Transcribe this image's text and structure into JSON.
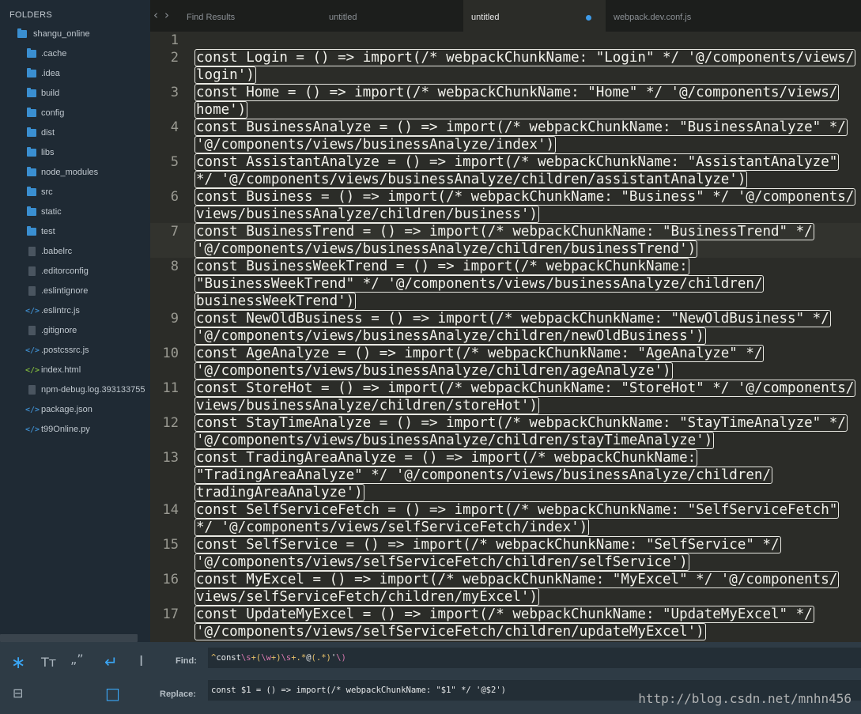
{
  "sidebar": {
    "header": "FOLDERS",
    "root": "shangu_online",
    "items": [
      {
        "label": ".cache",
        "icon": "folder-icon"
      },
      {
        "label": ".idea",
        "icon": "folder-icon"
      },
      {
        "label": "build",
        "icon": "folder-icon"
      },
      {
        "label": "config",
        "icon": "folder-icon"
      },
      {
        "label": "dist",
        "icon": "folder-icon"
      },
      {
        "label": "libs",
        "icon": "folder-icon"
      },
      {
        "label": "node_modules",
        "icon": "folder-icon"
      },
      {
        "label": "src",
        "icon": "folder-icon"
      },
      {
        "label": "static",
        "icon": "folder-icon"
      },
      {
        "label": "test",
        "icon": "folder-icon"
      },
      {
        "label": ".babelrc",
        "icon": "file-icon"
      },
      {
        "label": ".editorconfig",
        "icon": "file-icon"
      },
      {
        "label": ".eslintignore",
        "icon": "file-icon"
      },
      {
        "label": ".eslintrc.js",
        "icon": "code-file-icon"
      },
      {
        "label": ".gitignore",
        "icon": "file-icon"
      },
      {
        "label": ".postcssrc.js",
        "icon": "code-file-icon"
      },
      {
        "label": "index.html",
        "icon": "html-file-icon"
      },
      {
        "label": "npm-debug.log.393133755",
        "icon": "file-icon"
      },
      {
        "label": "package.json",
        "icon": "code-file-icon"
      },
      {
        "label": "t99Online.py",
        "icon": "code-file-icon"
      }
    ]
  },
  "tabs": [
    {
      "label": "Find Results",
      "active": false
    },
    {
      "label": "untitled",
      "active": false
    },
    {
      "label": "untitled",
      "active": true,
      "modified": true
    },
    {
      "label": "webpack.dev.conf.js",
      "active": false
    }
  ],
  "editor": {
    "current_line": 7,
    "lines": [
      {
        "n": "1",
        "text": []
      },
      {
        "n": "2",
        "text": [
          "const Login = () => import(/* webpackChunkName: \"Login\" */ '@/components/views/",
          "login')"
        ]
      },
      {
        "n": "3",
        "text": [
          "const Home = () => import(/* webpackChunkName: \"Home\" */ '@/components/views/",
          "home')"
        ]
      },
      {
        "n": "4",
        "text": [
          "const BusinessAnalyze = () => import(/* webpackChunkName: \"BusinessAnalyze\" */",
          "'@/components/views/businessAnalyze/index')"
        ]
      },
      {
        "n": "5",
        "text": [
          "const AssistantAnalyze = () => import(/* webpackChunkName: \"AssistantAnalyze\"",
          "*/ '@/components/views/businessAnalyze/children/assistantAnalyze')"
        ]
      },
      {
        "n": "6",
        "text": [
          "const Business = () => import(/* webpackChunkName: \"Business\" */ '@/components/",
          "views/businessAnalyze/children/business')"
        ]
      },
      {
        "n": "7",
        "text": [
          "const BusinessTrend = () => import(/* webpackChunkName: \"BusinessTrend\" */",
          "'@/components/views/businessAnalyze/children/businessTrend')"
        ]
      },
      {
        "n": "8",
        "text": [
          "const BusinessWeekTrend = () => import(/* webpackChunkName:",
          "\"BusinessWeekTrend\" */ '@/components/views/businessAnalyze/children/",
          "businessWeekTrend')"
        ]
      },
      {
        "n": "9",
        "text": [
          "const NewOldBusiness = () => import(/* webpackChunkName: \"NewOldBusiness\" */",
          "'@/components/views/businessAnalyze/children/newOldBusiness')"
        ]
      },
      {
        "n": "10",
        "text": [
          "const AgeAnalyze = () => import(/* webpackChunkName: \"AgeAnalyze\" */",
          "'@/components/views/businessAnalyze/children/ageAnalyze')"
        ]
      },
      {
        "n": "11",
        "text": [
          "const StoreHot = () => import(/* webpackChunkName: \"StoreHot\" */ '@/components/",
          "views/businessAnalyze/children/storeHot')"
        ]
      },
      {
        "n": "12",
        "text": [
          "const StayTimeAnalyze = () => import(/* webpackChunkName: \"StayTimeAnalyze\" */",
          "'@/components/views/businessAnalyze/children/stayTimeAnalyze')"
        ]
      },
      {
        "n": "13",
        "text": [
          "const TradingAreaAnalyze = () => import(/* webpackChunkName:",
          "\"TradingAreaAnalyze\" */ '@/components/views/businessAnalyze/children/",
          "tradingAreaAnalyze')"
        ]
      },
      {
        "n": "14",
        "text": [
          "const SelfServiceFetch = () => import(/* webpackChunkName: \"SelfServiceFetch\"",
          "*/ '@/components/views/selfServiceFetch/index')"
        ]
      },
      {
        "n": "15",
        "text": [
          "const SelfService = () => import(/* webpackChunkName: \"SelfService\" */",
          "'@/components/views/selfServiceFetch/children/selfService')"
        ]
      },
      {
        "n": "16",
        "text": [
          "const MyExcel = () => import(/* webpackChunkName: \"MyExcel\" */ '@/components/",
          "views/selfServiceFetch/children/myExcel')"
        ]
      },
      {
        "n": "17",
        "text": [
          "const UpdateMyExcel = () => import(/* webpackChunkName: \"UpdateMyExcel\" */",
          "'@/components/views/selfServiceFetch/children/updateMyExcel')"
        ]
      }
    ]
  },
  "find_panel": {
    "find_label": "Find:",
    "replace_label": "Replace:",
    "find_value": "^const\\s+(\\w+)\\s+.*@(.*)'\\)",
    "replace_value": "const $1 = () => import(/* webpackChunkName: \"$1\" */ '@$2')",
    "options": [
      {
        "name": "regex-icon",
        "glyph": "∗",
        "on": true
      },
      {
        "name": "case-sensitive-icon",
        "glyph": "Tт",
        "on": false
      },
      {
        "name": "whole-word-icon",
        "glyph": "„”",
        "on": false
      },
      {
        "name": "wrap-icon",
        "glyph": "↵",
        "on": true
      },
      {
        "name": "in-selection-icon",
        "glyph": "I",
        "on": false
      },
      {
        "name": "preserve-case-icon",
        "glyph": "⊟",
        "on": false
      },
      {
        "name": "highlight-matches-icon",
        "glyph": "□",
        "on": true
      }
    ]
  },
  "watermark": "http://blog.csdn.net/mnhn456",
  "colors": {
    "accent": "#3aa6f5",
    "editor_bg": "#2b2c28",
    "sidebar_bg": "#1f2a34"
  }
}
